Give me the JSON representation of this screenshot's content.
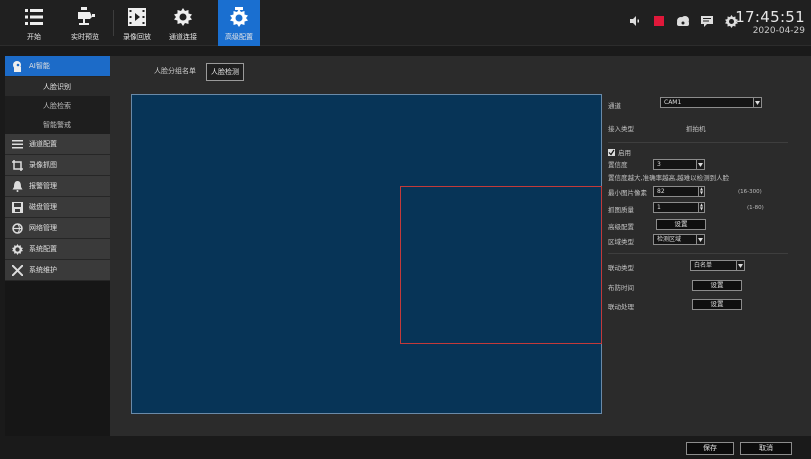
{
  "topbar": {
    "buttons": [
      {
        "label": "开始",
        "icon": "menu-list-icon"
      },
      {
        "label": "实时预览",
        "icon": "camera-icon"
      },
      {
        "label": "录像回放",
        "icon": "film-icon"
      },
      {
        "label": "通道连接",
        "icon": "gear-icon"
      },
      {
        "label": "高级配置",
        "icon": "gear-camera-icon"
      }
    ],
    "active_index": 4,
    "time": "17:45:51",
    "date": "2020-04-29",
    "status_icons": [
      "volume-icon",
      "record-icon",
      "cloud-icon",
      "message-icon",
      "settings-icon"
    ]
  },
  "sidebar": {
    "items": [
      {
        "label": "AI智能",
        "icon": "ai-head-icon",
        "active": true
      },
      {
        "label": "通道配置",
        "icon": "channel-list-icon"
      },
      {
        "label": "录像抓图",
        "icon": "crop-icon"
      },
      {
        "label": "报警管理",
        "icon": "bell-icon"
      },
      {
        "label": "磁盘管理",
        "icon": "disk-icon"
      },
      {
        "label": "网络管理",
        "icon": "network-icon"
      },
      {
        "label": "系统配置",
        "icon": "gear-icon"
      },
      {
        "label": "系统维护",
        "icon": "tools-icon"
      }
    ],
    "subitems": [
      {
        "label": "人脸识别",
        "active": true
      },
      {
        "label": "人脸检索"
      },
      {
        "label": "智能警戒"
      }
    ]
  },
  "tabs": [
    {
      "label": "人脸分组名单"
    },
    {
      "label": "人脸检测",
      "active": true
    }
  ],
  "settings": {
    "channel_label": "通道",
    "channel_value": "CAM1",
    "access_type_label": "接入类型",
    "access_type_value": "抓拍机",
    "enable_label": "启用",
    "confidence_label": "置信度",
    "confidence_value": "3",
    "confidence_hint": "置信度越大,准确率越高,越难以检测到人脸",
    "min_pixel_label": "最小图片像素",
    "min_pixel_value": "82",
    "min_pixel_range": "(16-300)",
    "capture_qty_label": "抓图质量",
    "capture_qty_value": "1",
    "capture_qty_range": "(1-80)",
    "advanced_label": "高级配置",
    "advanced_button": "设置",
    "region_type_label": "区域类型",
    "region_type_value": "检测区域",
    "link_type_label": "联动类型",
    "link_type_value": "白名单",
    "arm_time_label": "布防时间",
    "arm_time_button": "设置",
    "link_action_label": "联动处理",
    "link_action_button": "设置"
  },
  "footer": {
    "save": "保存",
    "cancel": "取消"
  }
}
